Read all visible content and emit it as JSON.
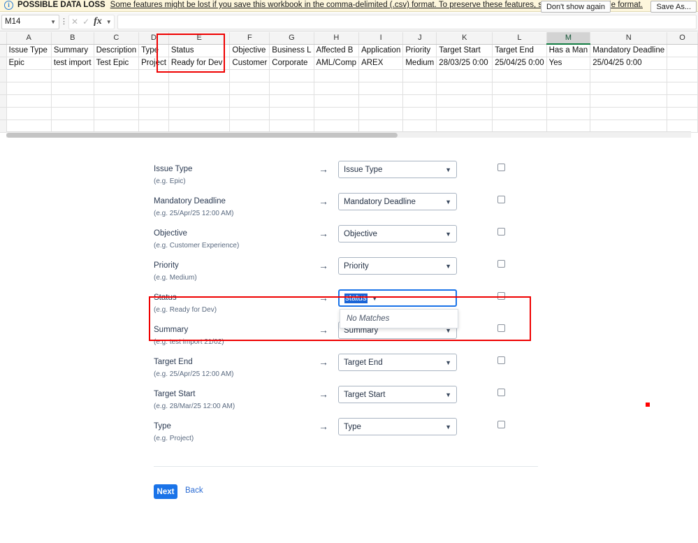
{
  "excel": {
    "banner": {
      "info_icon": "info-icon",
      "title": "POSSIBLE DATA LOSS",
      "message": "Some features might be lost if you save this workbook in the comma-delimited (.csv) format. To preserve these features, save it in an Excel file format.",
      "dont_show_label": "Don't show again",
      "save_as_label": "Save As..."
    },
    "formula_bar": {
      "name_box_value": "M14",
      "cancel_icon": "cancel-icon",
      "confirm_icon": "confirm-icon",
      "fx_icon": "fx-icon",
      "formula_value": ""
    },
    "grid": {
      "columns": [
        "A",
        "B",
        "C",
        "D",
        "E",
        "F",
        "G",
        "H",
        "I",
        "J",
        "K",
        "L",
        "M",
        "N",
        "O"
      ],
      "selected_column": "M",
      "highlighted_column": "E",
      "header_row": [
        "Issue Type",
        "Summary",
        "Description",
        "Type",
        "Status",
        "Objective",
        "Business L",
        "Affected B",
        "Application",
        "Priority",
        "Target Start",
        "Target End",
        "Has a Man",
        "Mandatory Deadline",
        ""
      ],
      "data_row": [
        "Epic",
        "test import",
        "Test Epic",
        "Project",
        "Ready for Dev",
        "Customer",
        "Corporate",
        "AML/Comp",
        "AREX",
        "Medium",
        "28/03/25 0:00",
        "25/04/25 0:00",
        "Yes",
        "25/04/25 0:00",
        ""
      ],
      "empty_rows": 5
    }
  },
  "form": {
    "arrow_glyph": "→",
    "rows": [
      {
        "label": "Issue Type",
        "example": "(e.g. Epic)",
        "select_value": "Issue Type",
        "checked": false,
        "highlighted": false
      },
      {
        "label": "Mandatory Deadline",
        "example": "(e.g. 25/Apr/25 12:00 AM)",
        "select_value": "Mandatory Deadline",
        "checked": false,
        "highlighted": false
      },
      {
        "label": "Objective",
        "example": "(e.g. Customer Experience)",
        "select_value": "Objective",
        "checked": false,
        "highlighted": false
      },
      {
        "label": "Priority",
        "example": "(e.g. Medium)",
        "select_value": "Priority",
        "checked": false,
        "highlighted": false
      },
      {
        "label": "Status",
        "example": "(e.g. Ready for Dev)",
        "select_value": "status",
        "checked": false,
        "highlighted": true
      },
      {
        "label": "Summary",
        "example": "(e.g. test import 21/02)",
        "select_value": "Summary",
        "checked": false,
        "highlighted": false
      },
      {
        "label": "Target End",
        "example": "(e.g. 25/Apr/25 12:00 AM)",
        "select_value": "Target End",
        "checked": false,
        "highlighted": false
      },
      {
        "label": "Target Start",
        "example": "(e.g. 28/Mar/25 12:00 AM)",
        "select_value": "Target Start",
        "checked": false,
        "highlighted": false
      },
      {
        "label": "Type",
        "example": "(e.g. Project)",
        "select_value": "Type",
        "checked": false,
        "highlighted": false
      }
    ],
    "status_dropdown": {
      "open": true,
      "no_matches_label": "No Matches"
    },
    "footer": {
      "next_label": "Next",
      "back_label": "Back"
    }
  },
  "colors": {
    "banner_bg": "#fdf6dc",
    "accent_blue": "#1a73e8",
    "selection_blue": "#1a64d6",
    "annotation_red": "#ef0000",
    "excel_green": "#107c41"
  }
}
